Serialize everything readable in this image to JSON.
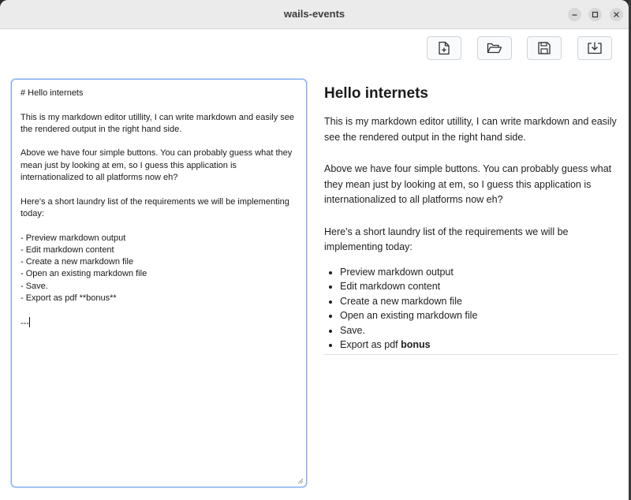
{
  "window": {
    "title": "wails-events"
  },
  "toolbar": {
    "buttons": [
      {
        "name": "new-file",
        "icon": "file-plus-icon"
      },
      {
        "name": "open-file",
        "icon": "folder-open-icon"
      },
      {
        "name": "save-file",
        "icon": "save-icon"
      },
      {
        "name": "export",
        "icon": "download-icon"
      }
    ]
  },
  "editor": {
    "content": "# Hello internets\n\nThis is my markdown editor utillity, I can write markdown and easily see the rendered output in the right hand side.\n\nAbove we have four simple buttons. You can probably guess what they mean just by looking at em, so I guess this application is internationalized to all platforms now eh?\n\nHere's a short laundry list of the requirements we will be implementing today:\n\n- Preview markdown output\n- Edit markdown content\n- Create a new markdown file\n- Open an existing markdown file\n- Save.\n- Export as pdf **bonus**\n\n---"
  },
  "preview": {
    "heading": "Hello internets",
    "paragraphs": [
      "This is my markdown editor utillity, I can write markdown and easily see the rendered output in the right hand side.",
      "Above we have four simple buttons. You can probably guess what they mean just by looking at em, so I guess this application is internationalized to all platforms now eh?",
      "Here's a short laundry list of the requirements we will be implementing today:"
    ],
    "list": [
      "Preview markdown output",
      "Edit markdown content",
      "Create a new markdown file",
      "Open an existing markdown file",
      "Save."
    ],
    "last_item_prefix": "Export as pdf",
    "last_item_bold": "bonus"
  }
}
